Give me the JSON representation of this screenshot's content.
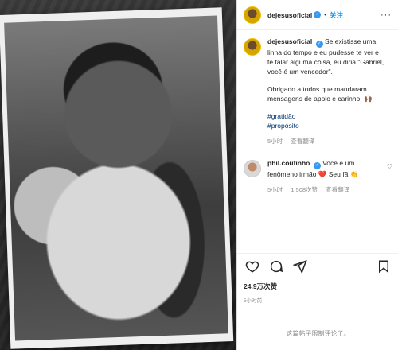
{
  "header": {
    "username": "dejesusoficial",
    "separator": "•",
    "follow_label": "关注",
    "more_label": "···"
  },
  "caption": {
    "author": "dejesusoficial",
    "text": "Se existisse uma linha do tempo e eu pudesse te ver e te falar alguma coisa, eu diria \"Gabriel, você é um vencedor\".",
    "text2": "Obrigado a todos que mandaram mensagens de apoio e carinho! 🙌🏾",
    "tags": [
      "#gratidão",
      "#propósito"
    ],
    "time": "5小时",
    "translate": "查看翻译"
  },
  "comment": {
    "author": "phil.coutinho",
    "text": "Você é um fenômeno irmão ❤️ Seu fã 👏",
    "time": "5小时",
    "likes": "1,508次赞",
    "translate": "查看翻译"
  },
  "actions": {
    "like_icon": "heart-icon",
    "comment_icon": "comment-icon",
    "share_icon": "share-icon",
    "save_icon": "bookmark-icon"
  },
  "likes_count": "24.9万次赞",
  "post_time": "5小时前",
  "footer_text": "这篇帖子限制评论了。",
  "colors": {
    "accent": "#0095f6",
    "verified": "#3897f0",
    "muted": "#8e8e8e",
    "hashtag": "#00376b"
  }
}
